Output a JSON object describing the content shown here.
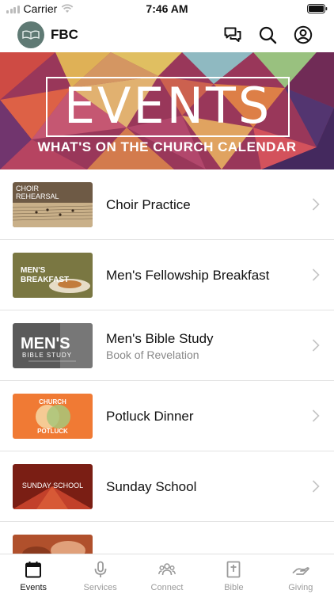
{
  "status_bar": {
    "carrier": "Carrier",
    "time": "7:46 AM"
  },
  "header": {
    "app_name": "FBC"
  },
  "banner": {
    "title": "EVENTS",
    "subtitle": "WHAT'S ON THE CHURCH CALENDAR"
  },
  "events": [
    {
      "title": "Choir Practice",
      "subtitle": "",
      "thumb_text": "CHOIR\nREHEARSAL"
    },
    {
      "title": "Men's Fellowship Breakfast",
      "subtitle": "",
      "thumb_text": "MEN'S BREAKFAST"
    },
    {
      "title": "Men's Bible Study",
      "subtitle": "Book of Revelation",
      "thumb_text": "MEN'S BIBLE STUDY"
    },
    {
      "title": "Potluck Dinner",
      "subtitle": "",
      "thumb_text": "CHURCH POTLUCK"
    },
    {
      "title": "Sunday School",
      "subtitle": "",
      "thumb_text": "SUNDAY SCHOOL"
    }
  ],
  "tabs": [
    {
      "label": "Events",
      "icon": "calendar-icon",
      "active": true
    },
    {
      "label": "Services",
      "icon": "microphone-icon",
      "active": false
    },
    {
      "label": "Connect",
      "icon": "people-icon",
      "active": false
    },
    {
      "label": "Bible",
      "icon": "bible-icon",
      "active": false
    },
    {
      "label": "Giving",
      "icon": "giving-hand-icon",
      "active": false
    }
  ],
  "colors": {
    "accent": "#111111",
    "inactive_tab": "#9a9a9a",
    "potluck_orange": "#f07a34"
  }
}
